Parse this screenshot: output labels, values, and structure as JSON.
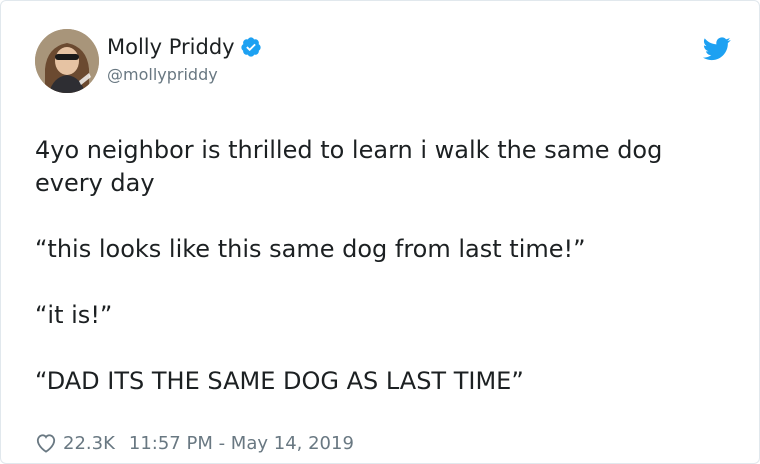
{
  "tweet": {
    "author_name": "Molly Priddy",
    "author_handle": "@mollypriddy",
    "paragraphs": [
      "4yo neighbor is thrilled to learn i walk the same dog every day",
      "“this looks like this same dog from last time!”",
      "“it is!”",
      "“DAD ITS THE SAME DOG AS LAST TIME”"
    ],
    "likes": "22.3K",
    "timestamp": "11:57 PM - May 14, 2019"
  },
  "icons": {
    "verified": "verified-badge-icon",
    "platform": "twitter-bird-icon",
    "like": "heart-icon"
  },
  "colors": {
    "accent": "#1da1f2",
    "text": "#1c2022",
    "muted": "#697882"
  }
}
